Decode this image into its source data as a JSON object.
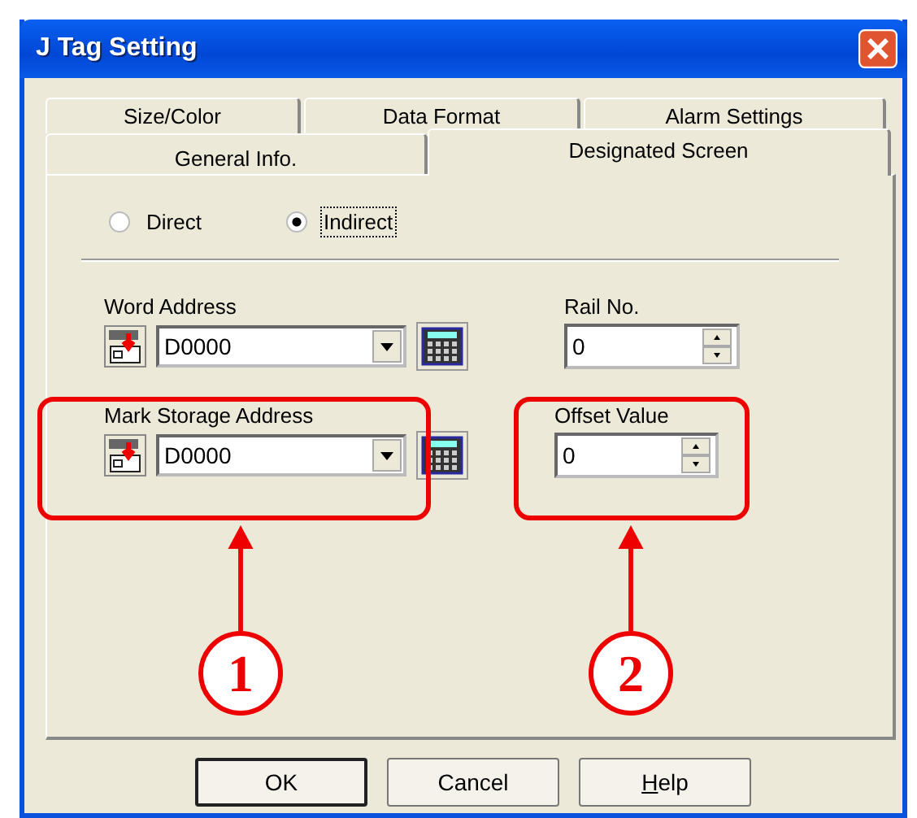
{
  "window": {
    "title": "J Tag Setting"
  },
  "tab_rows": [
    {
      "tabs": [
        {
          "label": "Size/Color",
          "selected": false
        },
        {
          "label": "Data Format",
          "selected": false
        },
        {
          "label": "Alarm Settings",
          "selected": false
        }
      ]
    },
    {
      "tabs": [
        {
          "label": "General Info.",
          "selected": false
        },
        {
          "label": "Designated Screen",
          "selected": true
        }
      ]
    }
  ],
  "mode": [
    {
      "label": "Direct",
      "selected": false,
      "focused": false
    },
    {
      "label": "Indirect",
      "selected": true,
      "focused": true
    }
  ],
  "fields": [
    {
      "kind": "address",
      "label": "Word Address",
      "value": "D0000"
    },
    {
      "kind": "spinner",
      "label": "Rail No.",
      "value": "0"
    },
    {
      "kind": "address",
      "label": "Mark Storage Address",
      "value": "D0000"
    },
    {
      "kind": "spinner",
      "label": "Offset Value",
      "value": "0"
    }
  ],
  "callouts": [
    {
      "number": "1"
    },
    {
      "number": "2"
    }
  ],
  "buttons": [
    {
      "label": "OK",
      "default": true,
      "mnemonic": false
    },
    {
      "label": "Cancel",
      "default": false,
      "mnemonic": false
    },
    {
      "label": "Help",
      "default": false,
      "mnemonic": true
    }
  ]
}
